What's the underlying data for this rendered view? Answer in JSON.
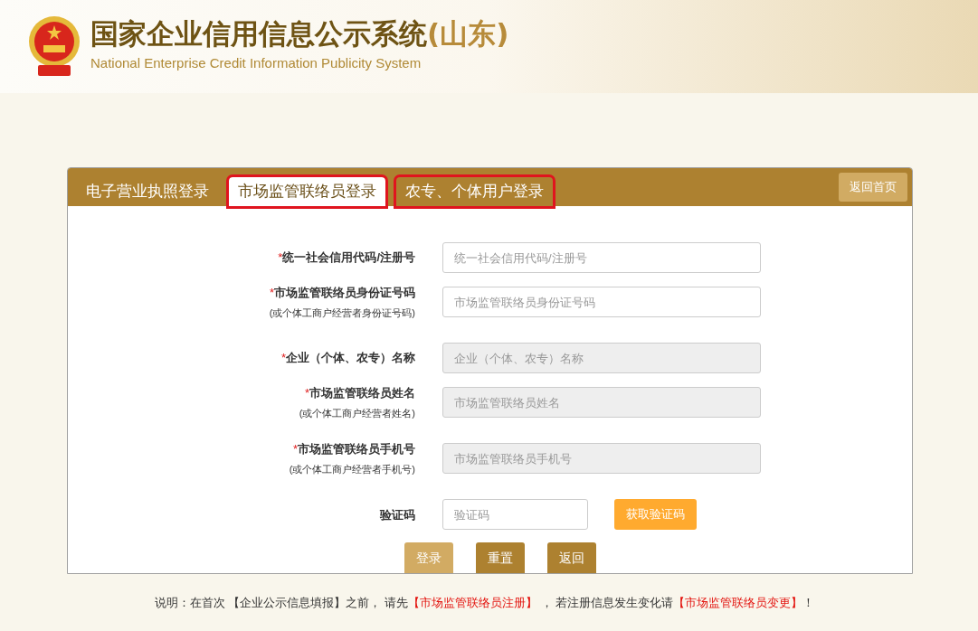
{
  "header": {
    "title": "国家企业信用信息公示系统",
    "region": "(山东)",
    "subtitle": "National Enterprise Credit Information Publicity System"
  },
  "tabs": [
    {
      "label": "电子营业执照登录",
      "selected": false,
      "highlighted": false
    },
    {
      "label": "市场监管联络员登录",
      "selected": true,
      "highlighted": true
    },
    {
      "label": "农专、个体用户登录",
      "selected": false,
      "highlighted": true
    }
  ],
  "home_button": "返回首页",
  "fields": [
    {
      "label": "统一社会信用代码/注册号",
      "marker": "*",
      "placeholder": "统一社会信用代码/注册号",
      "disabled": false
    },
    {
      "label": "市场监管联络员身份证号码",
      "note": "(或个体工商户经营者身份证号码)",
      "marker": "*",
      "placeholder": "市场监管联络员身份证号码",
      "disabled": false
    },
    {
      "label": "企业（个体、农专）名称",
      "marker": "*",
      "placeholder": "企业（个体、农专）名称",
      "disabled": true
    },
    {
      "label": "市场监管联络员姓名",
      "note": "(或个体工商户经营者姓名)",
      "marker": "*",
      "placeholder": "市场监管联络员姓名",
      "disabled": true
    },
    {
      "label": "市场监管联络员手机号",
      "note": "(或个体工商户经营者手机号)",
      "marker": "*",
      "placeholder": "市场监管联络员手机号",
      "disabled": true
    }
  ],
  "captcha": {
    "label": "验证码",
    "placeholder": "验证码",
    "button": "获取验证码"
  },
  "buttons": [
    {
      "label": "登录",
      "disabled": true
    },
    {
      "label": "重置",
      "disabled": false
    },
    {
      "label": "返回",
      "disabled": false
    }
  ],
  "note": [
    {
      "text": "说明：在首次 【企业公示信息填报】之前， 请先",
      "kind": "plain"
    },
    {
      "text": "【市场监管联络员注册】",
      "kind": "link"
    },
    {
      "text": " ， 若注册信息发生变化请",
      "kind": "plain"
    },
    {
      "text": "【市场监管联络员变更】",
      "kind": "link"
    },
    {
      "text": "！",
      "kind": "plain"
    }
  ]
}
